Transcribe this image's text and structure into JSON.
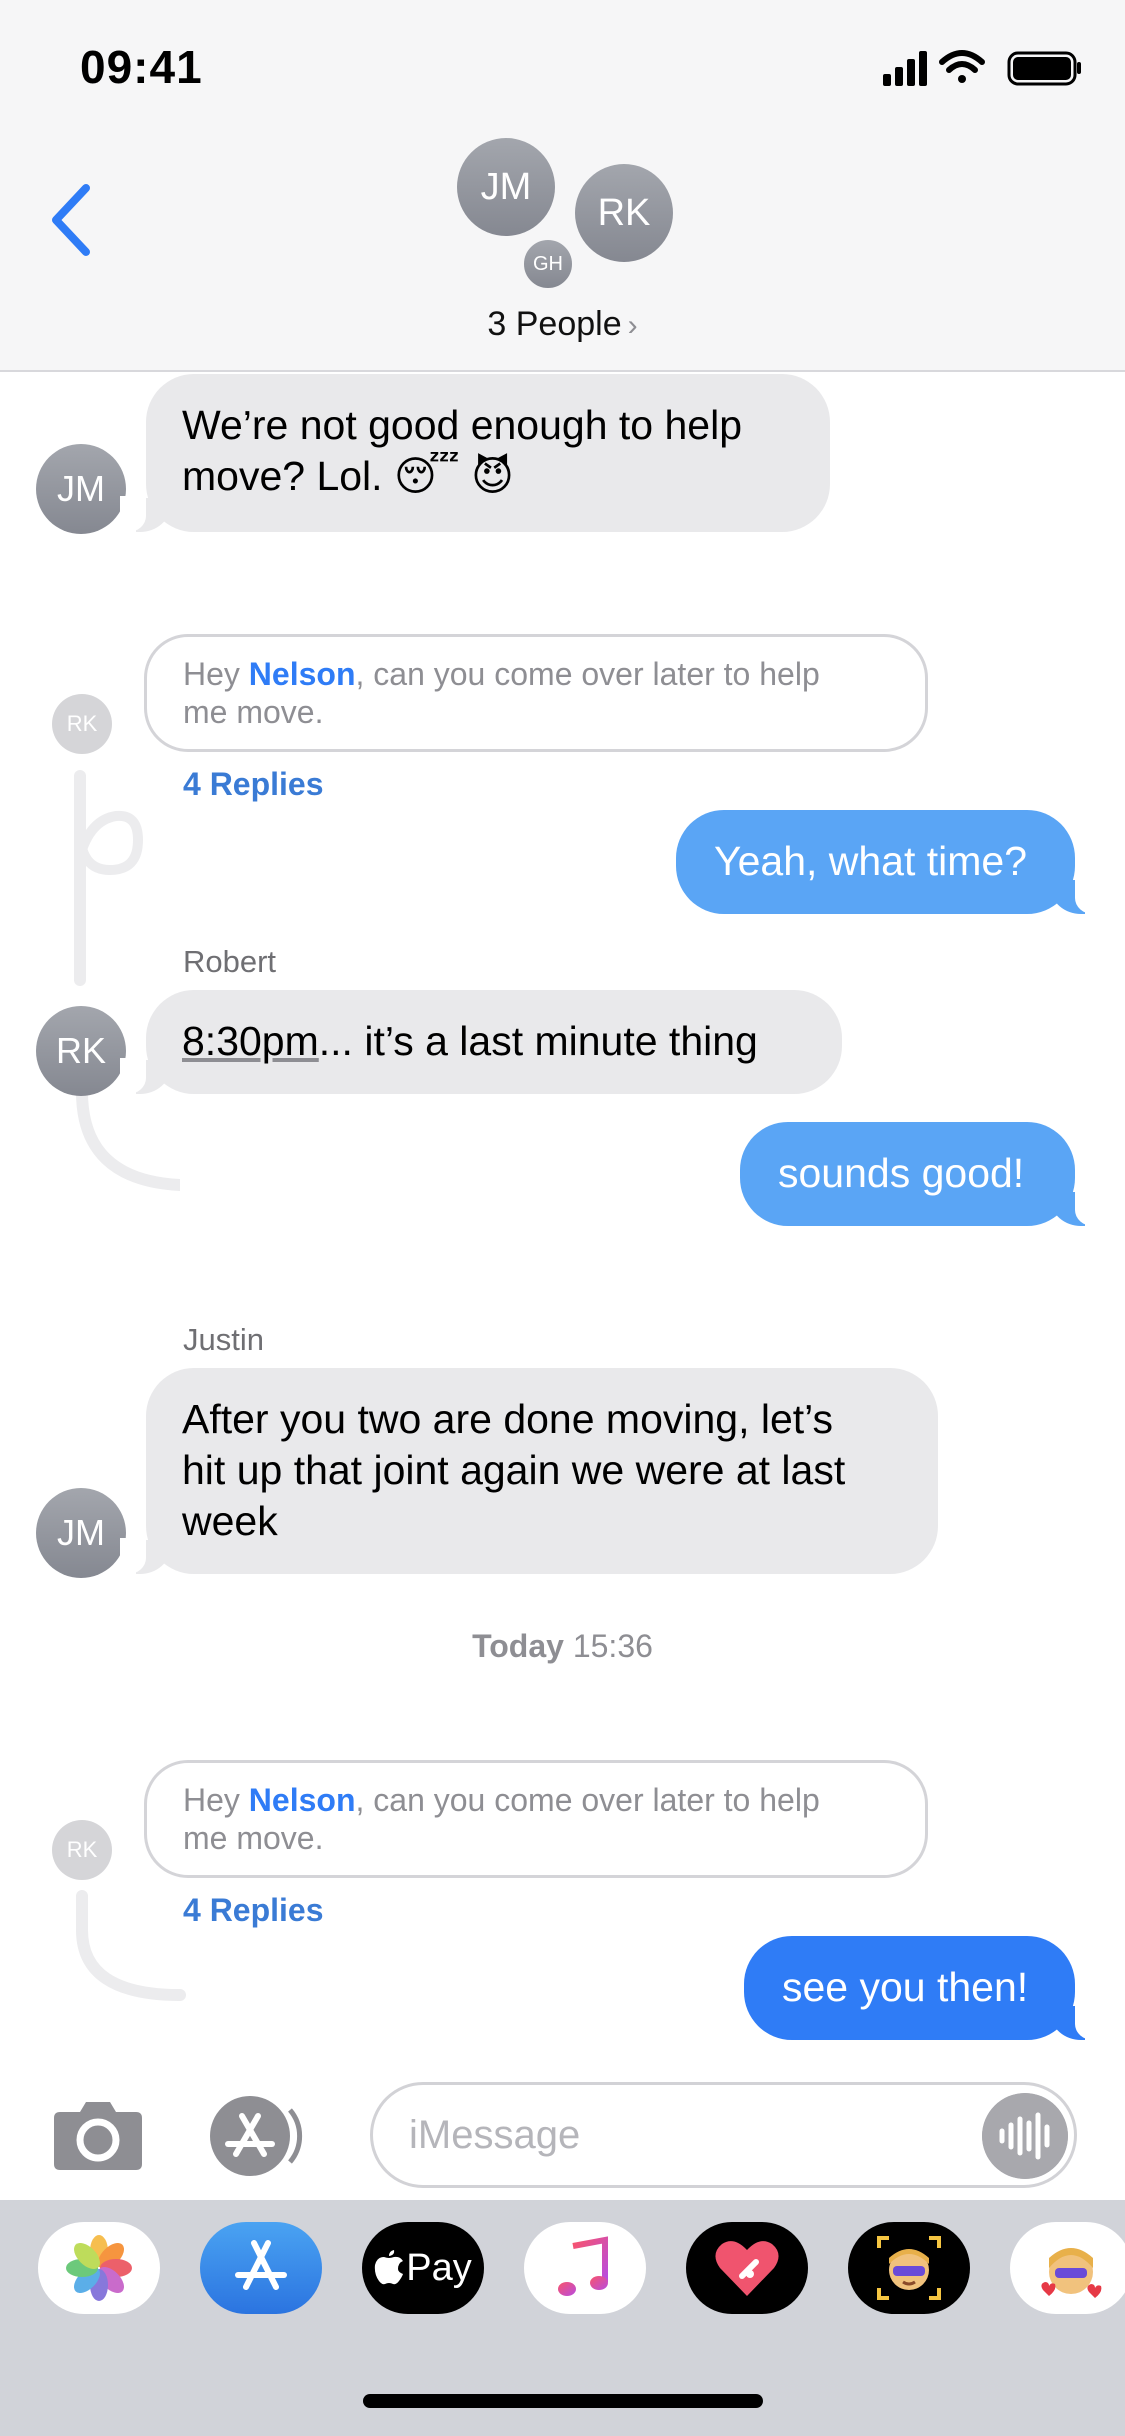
{
  "status_bar": {
    "time": "09:41"
  },
  "header": {
    "avatars": [
      "JM",
      "RK",
      "GH"
    ],
    "group_title": "3 People",
    "chevron": "›"
  },
  "messages": {
    "m1": {
      "avatar": "JM",
      "text_line1": "We’re not good enough to help",
      "text_line2": "move? Lol.",
      "emoji": "😴 😈"
    },
    "q1": {
      "avatar": "RK",
      "prefix": "Hey ",
      "mention": "Nelson",
      "text_a": ", can you come over later to help",
      "text_b": "me move.",
      "replies": "4 Replies"
    },
    "o1": {
      "text": "Yeah, what time?"
    },
    "m2": {
      "sender": "Robert",
      "avatar": "RK",
      "time_link": "8:30pm",
      "text": "... it’s a last minute thing"
    },
    "o2": {
      "text": "sounds good!"
    },
    "m3": {
      "sender": "Justin",
      "avatar": "JM",
      "line1": "After you two are done moving, let’s",
      "line2": "hit up that joint again we were at last",
      "line3": "week"
    },
    "timestamp": {
      "day": "Today",
      "time": "15:36"
    },
    "q2": {
      "avatar": "RK",
      "prefix": "Hey ",
      "mention": "Nelson",
      "text_a": ", can you come over later to help",
      "text_b": "me move.",
      "replies": "4 Replies"
    },
    "o3": {
      "text": "see you then!"
    }
  },
  "input": {
    "placeholder": "iMessage"
  },
  "drawer": {
    "apps": [
      "photos-app",
      "app-store",
      "apple-pay",
      "music",
      "digital-touch",
      "memoji",
      "animoji-stickers"
    ],
    "apple_pay_label": "Pay"
  },
  "colors": {
    "outgoing": "#5aa5f5",
    "outgoing_latest": "#2f7cf6",
    "incoming": "#e9e9eb",
    "mention": "#2f7cf6",
    "replies": "#3a7bd5"
  }
}
